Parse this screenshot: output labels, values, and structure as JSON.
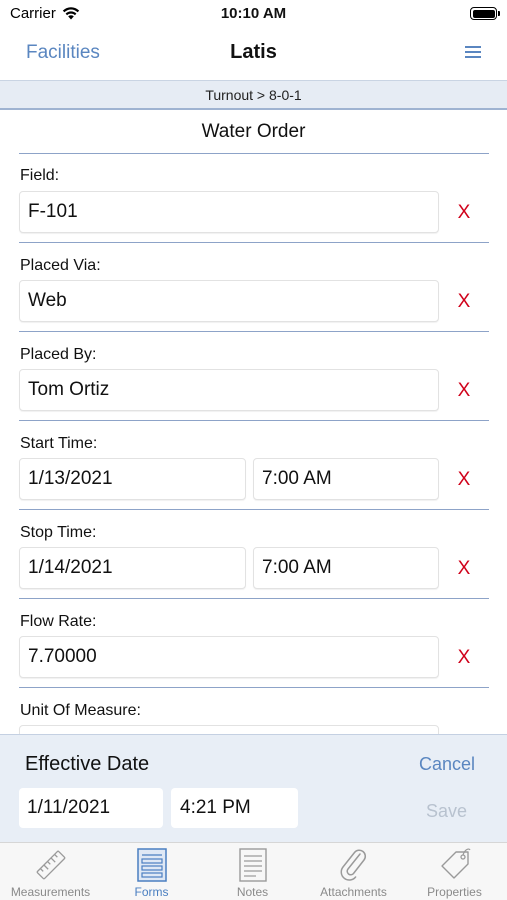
{
  "status_bar": {
    "carrier": "Carrier",
    "time": "10:10 AM"
  },
  "nav": {
    "back_label": "Facilities",
    "title": "Latis",
    "menu_icon": "hamburger-icon"
  },
  "breadcrumb": "Turnout > 8-0-1",
  "form": {
    "title": "Water Order",
    "clear_glyph": "X",
    "fields": {
      "field": {
        "label": "Field:",
        "value": "F-101"
      },
      "placed_via": {
        "label": "Placed Via:",
        "value": "Web"
      },
      "placed_by": {
        "label": "Placed By:",
        "value": "Tom Ortiz"
      },
      "start_time": {
        "label": "Start Time:",
        "date": "1/13/2021",
        "time": "7:00 AM"
      },
      "stop_time": {
        "label": "Stop Time:",
        "date": "1/14/2021",
        "time": "7:00 AM"
      },
      "flow_rate": {
        "label": "Flow Rate:",
        "value": "7.70000"
      },
      "unit_of_measure": {
        "label": "Unit Of Measure:",
        "value": ""
      }
    }
  },
  "effective_date": {
    "title": "Effective Date",
    "cancel_label": "Cancel",
    "date": "1/11/2021",
    "time": "4:21 PM",
    "save_label": "Save"
  },
  "tabs": [
    {
      "label": "Measurements",
      "icon": "ruler-icon",
      "active": false
    },
    {
      "label": "Forms",
      "icon": "form-icon",
      "active": true
    },
    {
      "label": "Notes",
      "icon": "notes-icon",
      "active": false
    },
    {
      "label": "Attachments",
      "icon": "paperclip-icon",
      "active": false
    },
    {
      "label": "Properties",
      "icon": "tag-icon",
      "active": false
    }
  ],
  "colors": {
    "accent": "#5a86c0",
    "clear": "#d0021b",
    "panel": "#e8eef6"
  }
}
